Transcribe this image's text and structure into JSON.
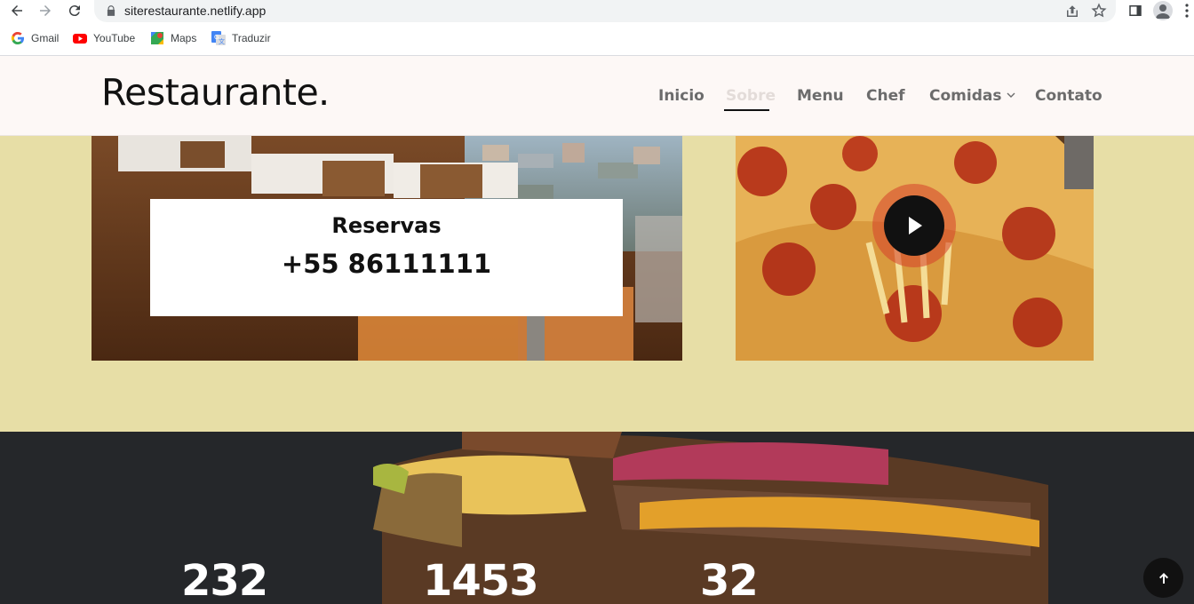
{
  "browser": {
    "url": "siterestaurante.netlify.app",
    "bookmarks": [
      {
        "label": "Gmail",
        "icon": "google-g-icon"
      },
      {
        "label": "YouTube",
        "icon": "youtube-icon"
      },
      {
        "label": "Maps",
        "icon": "maps-icon"
      },
      {
        "label": "Traduzir",
        "icon": "translate-icon"
      }
    ]
  },
  "site": {
    "brand": "Restaurante.",
    "menu": [
      {
        "label": "Inicio",
        "active": false
      },
      {
        "label": "Sobre",
        "active": true
      },
      {
        "label": "Menu",
        "active": false
      },
      {
        "label": "Chef",
        "active": false
      },
      {
        "label": "Comidas",
        "active": false,
        "dropdown": true
      },
      {
        "label": "Contato",
        "active": false
      }
    ]
  },
  "about": {
    "reservas_title": "Reservas",
    "reservas_phone": "+55 86111111"
  },
  "counters": [
    "232",
    "1453",
    "32"
  ],
  "colors": {
    "about_bg": "#e7dea6",
    "header_bg": "#fdf8f6",
    "play_accent": "#d6402a"
  }
}
